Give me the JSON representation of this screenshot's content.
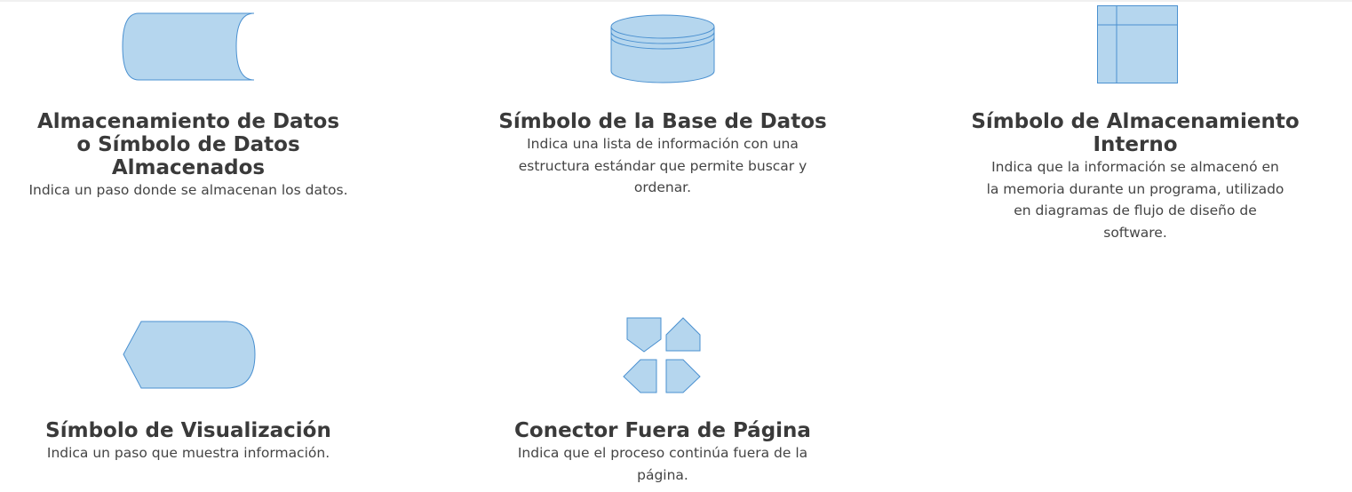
{
  "colors": {
    "fill": "#b5d6ee",
    "stroke": "#4a90d0",
    "text": "#3a3a3a"
  },
  "items": [
    {
      "icon": "stored-data-icon",
      "title": "Almacenamiento de Datos o Símbolo de Datos Almacenados",
      "desc": "Indica un paso donde se almacenan los datos."
    },
    {
      "icon": "database-icon",
      "title": "Símbolo de la Base de Datos",
      "desc": "Indica una lista de información con una estructura estándar que permite buscar y ordenar."
    },
    {
      "icon": "internal-storage-icon",
      "title": "Símbolo de Almacenamiento Interno",
      "desc": "Indica que la información se almacenó en la memoria durante un programa, utilizado en diagramas de flujo de diseño de software."
    },
    {
      "icon": "display-icon",
      "title": "Símbolo de Visualización",
      "desc": "Indica un paso que muestra información."
    },
    {
      "icon": "off-page-connector-icon",
      "title": "Conector Fuera de Página",
      "desc": "Indica que el proceso continúa fuera de la página."
    }
  ]
}
